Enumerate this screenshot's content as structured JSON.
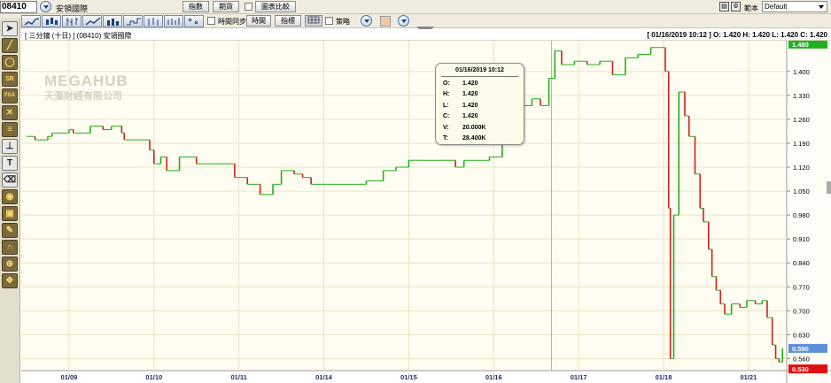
{
  "window": {
    "stock_code": "08410",
    "stock_name": "安領國際",
    "buttons": [
      "指數",
      "期貨",
      "圖表比較"
    ],
    "sync_label": "時間同步",
    "time_button": "時間",
    "indicator_button": "指標",
    "strategy_label": "策略",
    "scope_label": "範本",
    "scope_value": "Default"
  },
  "chart_header": {
    "left_text": "[ 三分鐘 (十日) ]  (08410)  安領國際",
    "right_text": "[ 01/16/2019 10:12 ]  O: 1.420  H: 1.420  L: 1.420  C: 1.420"
  },
  "watermark": {
    "line1": "MEGAHUB",
    "line2": "天滙財經有限公司"
  },
  "tooltip": {
    "title": "01/16/2019 10:12",
    "rows": [
      {
        "k": "O:",
        "v": "1.420"
      },
      {
        "k": "H:",
        "v": "1.420"
      },
      {
        "k": "L:",
        "v": "1.420"
      },
      {
        "k": "C:",
        "v": "1.420"
      },
      {
        "k": "V:",
        "v": "20.000K"
      },
      {
        "k": "T:",
        "v": "28.400K"
      }
    ]
  },
  "colors": {
    "up": "#22b01c",
    "down": "#d0201c",
    "background": "#fffdf1",
    "grid": "#e9e4c7",
    "current_label_bg": "#5b8fd6",
    "low_label_bg": "#e01010",
    "high_label_bg": "#21b021"
  },
  "chart_data": {
    "type": "line",
    "title": "",
    "y_ticks": [
      0.56,
      0.63,
      0.7,
      0.77,
      0.84,
      0.91,
      0.98,
      1.05,
      1.12,
      1.19,
      1.26,
      1.33,
      1.4
    ],
    "y_tick_labels": [
      "0.560",
      "0.630",
      "0.700",
      "0.770",
      "0.840",
      "0.910",
      "0.980",
      "1.050",
      "1.120",
      "1.190",
      "1.260",
      "1.330",
      "1.400"
    ],
    "ylim": [
      0.525,
      1.49
    ],
    "x_labels": [
      "01/09",
      "01/10",
      "01/11",
      "01/14",
      "01/15",
      "01/16",
      "01/17",
      "01/18",
      "01/21"
    ],
    "x_label_positions": [
      0.5,
      1.5,
      2.5,
      3.5,
      4.5,
      5.5,
      6.5,
      7.5,
      8.5
    ],
    "xlim": [
      0,
      8.95
    ],
    "markers": {
      "high": "1.480",
      "current": "0.590",
      "low": "0.530"
    },
    "cursor_x": 6.18,
    "series": [
      {
        "points": [
          [
            0.0,
            1.21
          ],
          [
            0.05,
            1.21
          ],
          [
            0.1,
            1.2
          ],
          [
            0.2,
            1.2
          ],
          [
            0.25,
            1.21
          ],
          [
            0.3,
            1.22
          ],
          [
            0.5,
            1.23
          ],
          [
            0.55,
            1.22
          ],
          [
            0.75,
            1.24
          ],
          [
            0.9,
            1.23
          ],
          [
            1.0,
            1.24
          ],
          [
            1.12,
            1.22
          ],
          [
            1.15,
            1.2
          ],
          [
            1.3,
            1.2
          ],
          [
            1.45,
            1.17
          ],
          [
            1.5,
            1.13
          ],
          [
            1.58,
            1.15
          ],
          [
            1.65,
            1.11
          ],
          [
            1.8,
            1.15
          ],
          [
            2.0,
            1.13
          ],
          [
            2.3,
            1.13
          ],
          [
            2.45,
            1.09
          ],
          [
            2.6,
            1.07
          ],
          [
            2.75,
            1.04
          ],
          [
            2.9,
            1.07
          ],
          [
            3.0,
            1.11
          ],
          [
            3.15,
            1.1
          ],
          [
            3.25,
            1.09
          ],
          [
            3.35,
            1.07
          ],
          [
            3.5,
            1.07
          ],
          [
            3.65,
            1.07
          ],
          [
            3.85,
            1.07
          ],
          [
            4.0,
            1.08
          ],
          [
            4.2,
            1.11
          ],
          [
            4.35,
            1.12
          ],
          [
            4.5,
            1.14
          ],
          [
            4.7,
            1.14
          ],
          [
            4.85,
            1.14
          ],
          [
            5.05,
            1.12
          ],
          [
            5.15,
            1.14
          ],
          [
            5.3,
            1.14
          ],
          [
            5.45,
            1.15
          ],
          [
            5.6,
            1.19
          ],
          [
            5.7,
            1.33
          ],
          [
            5.75,
            1.26
          ],
          [
            5.85,
            1.3
          ],
          [
            5.95,
            1.32
          ],
          [
            6.05,
            1.3
          ],
          [
            6.15,
            1.38
          ],
          [
            6.22,
            1.46
          ],
          [
            6.3,
            1.42
          ],
          [
            6.45,
            1.43
          ],
          [
            6.6,
            1.42
          ],
          [
            6.75,
            1.43
          ],
          [
            6.9,
            1.39
          ],
          [
            7.05,
            1.44
          ],
          [
            7.2,
            1.45
          ],
          [
            7.35,
            1.47
          ],
          [
            7.45,
            1.47
          ],
          [
            7.52,
            1.4
          ],
          [
            7.56,
            1.0
          ],
          [
            7.58,
            0.56
          ],
          [
            7.62,
            0.98
          ],
          [
            7.68,
            1.34
          ],
          [
            7.75,
            1.27
          ],
          [
            7.8,
            1.21
          ],
          [
            7.87,
            1.1
          ],
          [
            7.93,
            1.0
          ],
          [
            7.97,
            0.96
          ],
          [
            8.03,
            0.88
          ],
          [
            8.07,
            0.8
          ],
          [
            8.12,
            0.76
          ],
          [
            8.17,
            0.72
          ],
          [
            8.22,
            0.69
          ],
          [
            8.3,
            0.72
          ],
          [
            8.4,
            0.71
          ],
          [
            8.48,
            0.73
          ],
          [
            8.58,
            0.72
          ],
          [
            8.66,
            0.73
          ],
          [
            8.72,
            0.68
          ],
          [
            8.78,
            0.6
          ],
          [
            8.82,
            0.56
          ],
          [
            8.86,
            0.55
          ],
          [
            8.9,
            0.59
          ]
        ]
      }
    ]
  }
}
